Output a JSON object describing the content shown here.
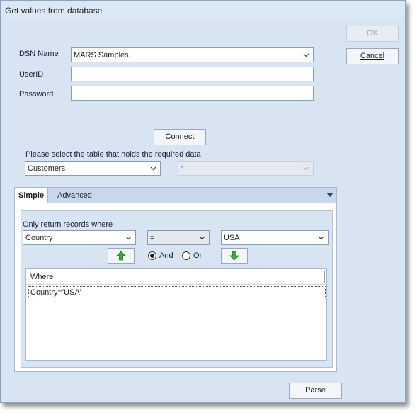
{
  "window": {
    "title": "Get values from database"
  },
  "buttons": {
    "ok": "OK",
    "cancel": "Cancel",
    "connect": "Connect",
    "parse": "Parse"
  },
  "form": {
    "dsn_label": "DSN Name",
    "dsn_value": "MARS Samples",
    "userid_label": "UserID",
    "userid_value": "",
    "password_label": "Password",
    "password_value": ""
  },
  "table_select": {
    "prompt": "Please select the table that holds the required data",
    "table_value": "Customers",
    "column_value": "*"
  },
  "tabs": [
    {
      "label": "Simple",
      "active": true
    },
    {
      "label": "Advanced",
      "active": false
    }
  ],
  "filter": {
    "prompt": "Only return records where",
    "field_value": "Country",
    "operator_value": "=",
    "compare_value": "USA",
    "and_label": "And",
    "or_label": "Or",
    "logic_selected": "And"
  },
  "where_grid": {
    "header": "Where",
    "rows": [
      "Country='USA'"
    ]
  },
  "icons": {
    "move_up": "green-up-arrow-icon",
    "move_down": "green-down-arrow-icon",
    "dropdown": "chevron-down-icon",
    "tab_menu": "triangle-down-icon"
  },
  "colors": {
    "dialog_bg": "#d8e4f2",
    "arrow_green": "#2fa32f"
  }
}
